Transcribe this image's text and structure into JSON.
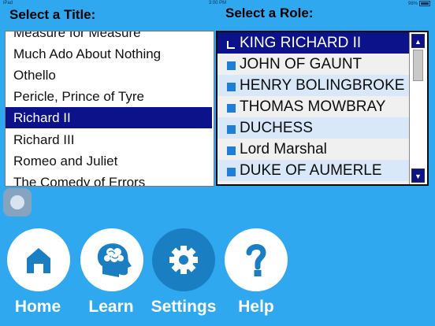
{
  "status_bar": {
    "device": "iPad",
    "time": "3:00 PM",
    "battery": "98%"
  },
  "title_list": {
    "heading": "Select a Title:",
    "items": [
      "Measure for Measure",
      "Much Ado About Nothing",
      "Othello",
      "Pericle, Prince of Tyre",
      "Richard II",
      "Richard III",
      "Romeo and Juliet",
      "The Comedy of Errors"
    ],
    "selected": "Richard II"
  },
  "role_list": {
    "heading": "Select a Role:",
    "items": [
      "KING RICHARD II",
      "JOHN OF GAUNT",
      "HENRY BOLINGBROKE",
      "THOMAS MOWBRAY",
      "DUCHESS",
      "Lord Marshal",
      "DUKE OF AUMERLE"
    ],
    "selected": "KING RICHARD II"
  },
  "nav": {
    "home": "Home",
    "learn": "Learn",
    "settings": "Settings",
    "help": "Help",
    "active": "Settings"
  },
  "colors": {
    "background": "#30a8ef",
    "selection": "#0b128a",
    "active_nav": "#1a7ec2"
  }
}
